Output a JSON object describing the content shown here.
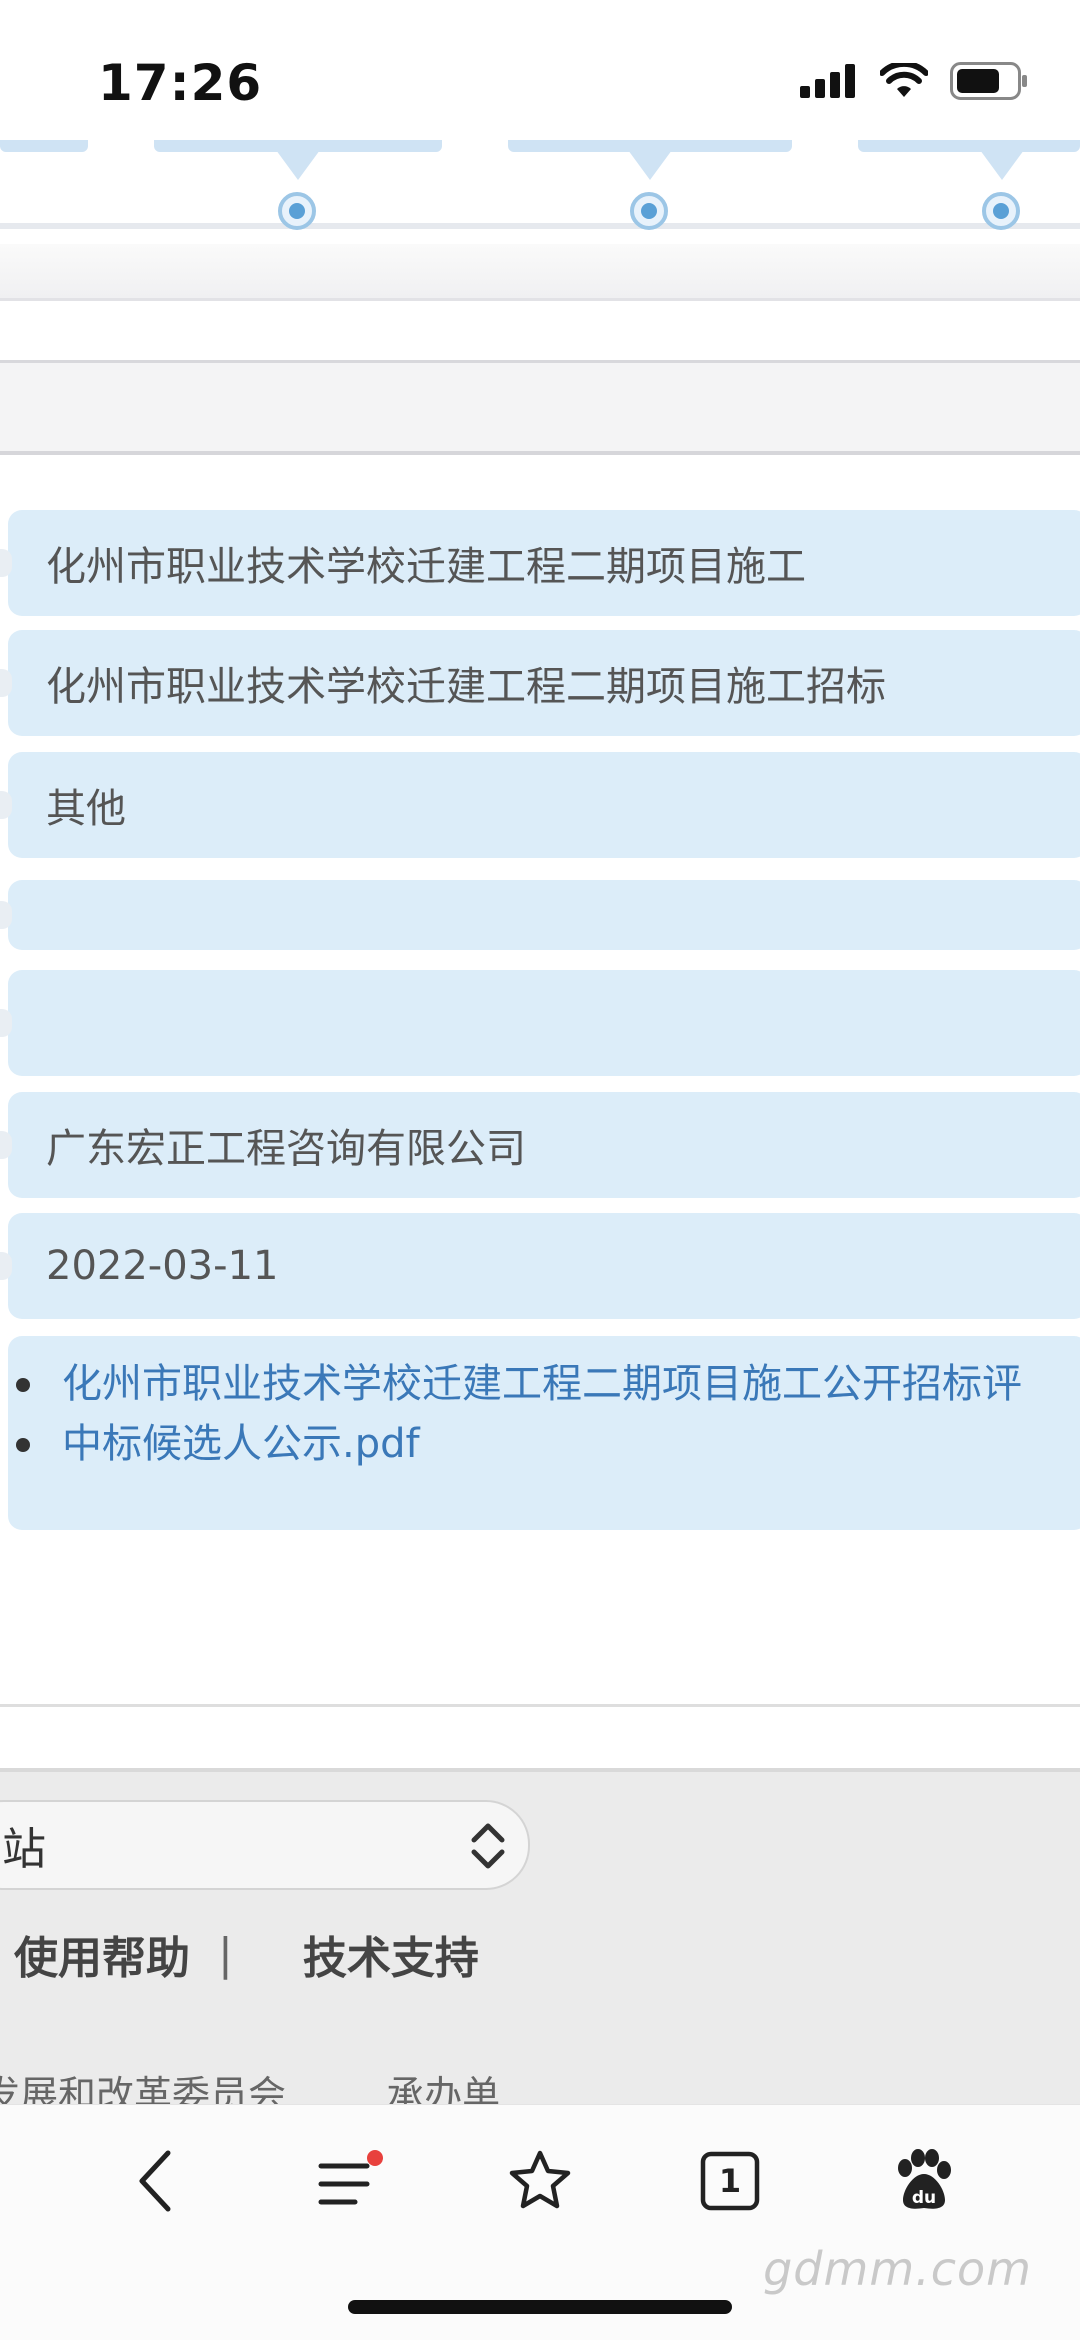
{
  "status_bar": {
    "time": "17:26",
    "icons": [
      "signal-icon",
      "wifi-icon",
      "battery-icon"
    ]
  },
  "timeline": {
    "nodes": 3
  },
  "details": {
    "project_name": "化州市职业技术学校迁建工程二期项目施工",
    "tender_name": "化州市职业技术学校迁建工程二期项目施工招标",
    "category": "其他",
    "empty_field_1": "",
    "empty_field_2": "",
    "agency": "广东宏正工程咨询有限公司",
    "date": "2022-03-11",
    "attachments": [
      "化州市职业技术学校迁建工程二期项目施工公开招标评",
      "中标候选人公示.pdf"
    ]
  },
  "footer": {
    "site_select": "站",
    "links": [
      "使用帮助",
      "技术支持"
    ],
    "separator": "|",
    "info_left": "发展和改革委员会",
    "info_right": "承办单"
  },
  "browser_toolbar": {
    "buttons": [
      "back-icon",
      "menu-icon",
      "bookmark-star-icon",
      "tabs-icon",
      "baidu-paw-icon"
    ],
    "tab_count": "1"
  },
  "watermark": "gdmm.com",
  "colors": {
    "field_bg": "#dcedf9",
    "link": "#3a78b8",
    "timeline_accent": "#5aa0d6",
    "notification_dot": "#e8413d"
  }
}
